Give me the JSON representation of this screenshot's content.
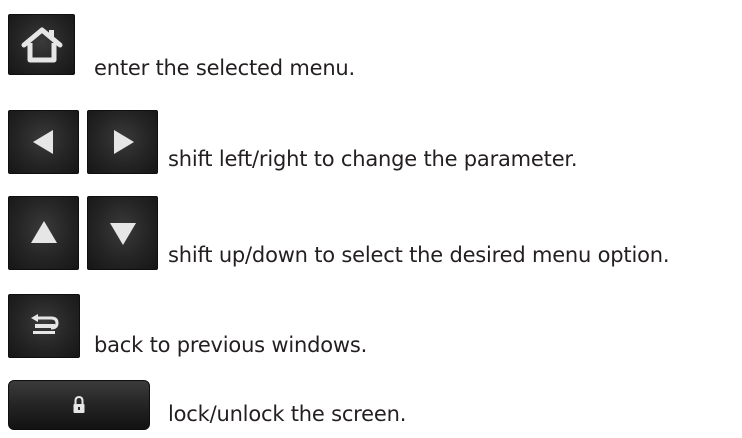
{
  "rows": [
    {
      "icon": "home-icon",
      "text": "enter the selected menu."
    },
    {
      "icon": "left-right-arrow-icons",
      "text": "shift left/right to change the parameter."
    },
    {
      "icon": "up-down-arrow-icons",
      "text": "shift up/down to select the desired menu option."
    },
    {
      "icon": "back-icon",
      "text": "back to previous windows."
    },
    {
      "icon": "lock-icon",
      "text": "lock/unlock the screen."
    }
  ],
  "colors": {
    "text": "#231f20",
    "button_bg": "#242424",
    "icon_glyph": "#e6e6e6"
  }
}
